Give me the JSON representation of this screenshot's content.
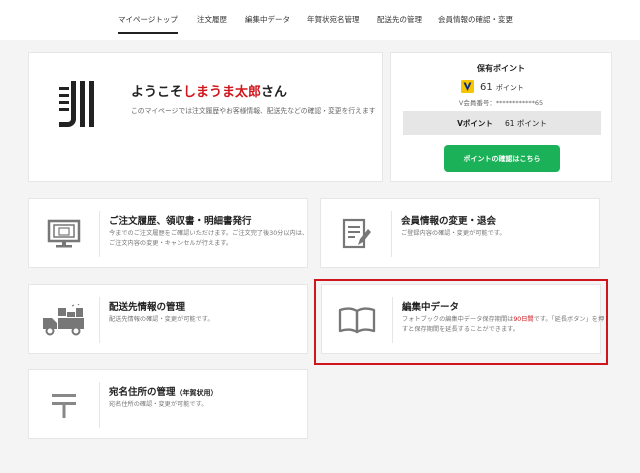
{
  "nav": {
    "items": [
      {
        "label": "マイページトップ",
        "active": true
      },
      {
        "label": "注文履歴"
      },
      {
        "label": "編集中データ"
      },
      {
        "label": "年賀状宛名管理"
      },
      {
        "label": "配送先の管理"
      },
      {
        "label": "会員情報の確認・変更"
      }
    ]
  },
  "welcome": {
    "prefix": "ようこそ",
    "name": "しまうま太郎",
    "suffix": "さん",
    "description": "このマイページでは注文履歴やお客様情報、配送先などの確認・変更を行えます"
  },
  "points": {
    "title": "保有ポイント",
    "amount": "61",
    "unit": "ポイント",
    "member_label": "V会員番号：",
    "member_number": "************65",
    "vpoint_label": "Vポイント",
    "vpoint_value": "61 ポイント",
    "button_label": "ポイントの確認はこちら"
  },
  "menu": {
    "orders": {
      "title": "ご注文履歴、領収書・明細書発行",
      "desc": "今までのご注文履歴をご確認いただけます。ご注文完了後30分以内は、ご注文内容の変更・キャンセルが行えます。"
    },
    "member": {
      "title": "会員情報の変更・退会",
      "desc": "ご登録内容の確認・変更が可能です。"
    },
    "shipping": {
      "title": "配送先情報の管理",
      "desc": "配送先情報の確認・変更が可能です。"
    },
    "editing": {
      "title": "編集中データ",
      "desc_pre": "フォトブックの編集中データ保存期間は",
      "desc_red": "90日間",
      "desc_post": "です。「延長ボタン」を押すと保存期間を延長することができます。"
    },
    "address": {
      "title": "宛名住所の管理",
      "title_sub": "（年賀状用）",
      "desc": "宛名住所の確認・変更が可能です。"
    }
  },
  "colors": {
    "accent_red": "#d0161d",
    "button_green": "#1bb158"
  }
}
